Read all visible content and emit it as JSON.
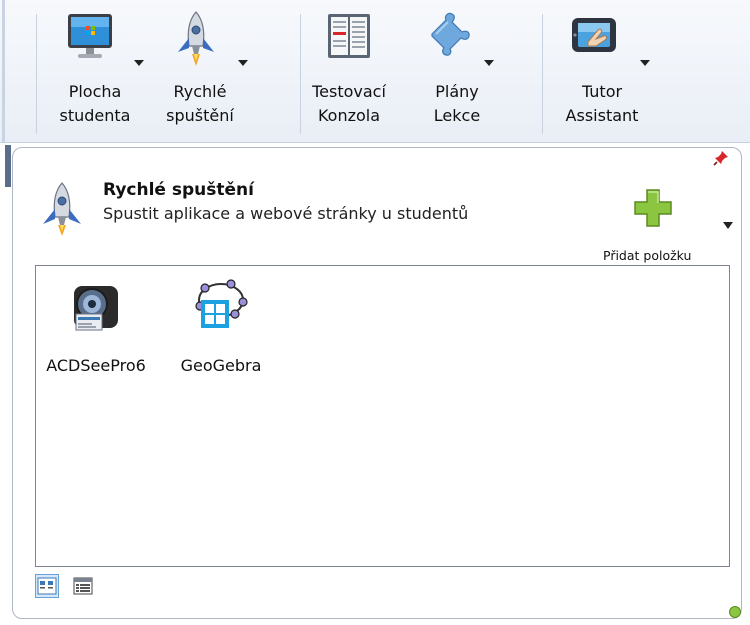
{
  "ribbon": {
    "buttons": [
      {
        "line1": "Plocha",
        "line2": "studenta",
        "icon": "monitor-icon",
        "has_dropdown": true
      },
      {
        "line1": "Rychlé",
        "line2": "spuštění",
        "icon": "rocket-icon",
        "has_dropdown": true
      },
      {
        "line1": "Testovací",
        "line2": "Konzola",
        "icon": "test-book-icon",
        "has_dropdown": false
      },
      {
        "line1": "Plány",
        "line2": "Lekce",
        "icon": "puzzle-icon",
        "has_dropdown": true
      },
      {
        "line1": "Tutor",
        "line2": "Assistant",
        "icon": "tablet-hand-icon",
        "has_dropdown": true
      }
    ]
  },
  "panel": {
    "title": "Rychlé spuštění",
    "subtitle": "Spustit aplikace a webové stránky u studentů",
    "add_label": "Přidat položku",
    "icon": "rocket-icon"
  },
  "apps": [
    {
      "label": "ACDSeePro6",
      "icon": "camera-icon"
    },
    {
      "label": "GeoGebra",
      "icon": "geogebra-icon"
    }
  ],
  "view": {
    "selected": "icons"
  },
  "colors": {
    "ribbon_bg": "#eef2f8",
    "panel_border": "#b0b7c2",
    "accent_green": "#7dc142",
    "selection_blue": "#d5e7fa"
  }
}
